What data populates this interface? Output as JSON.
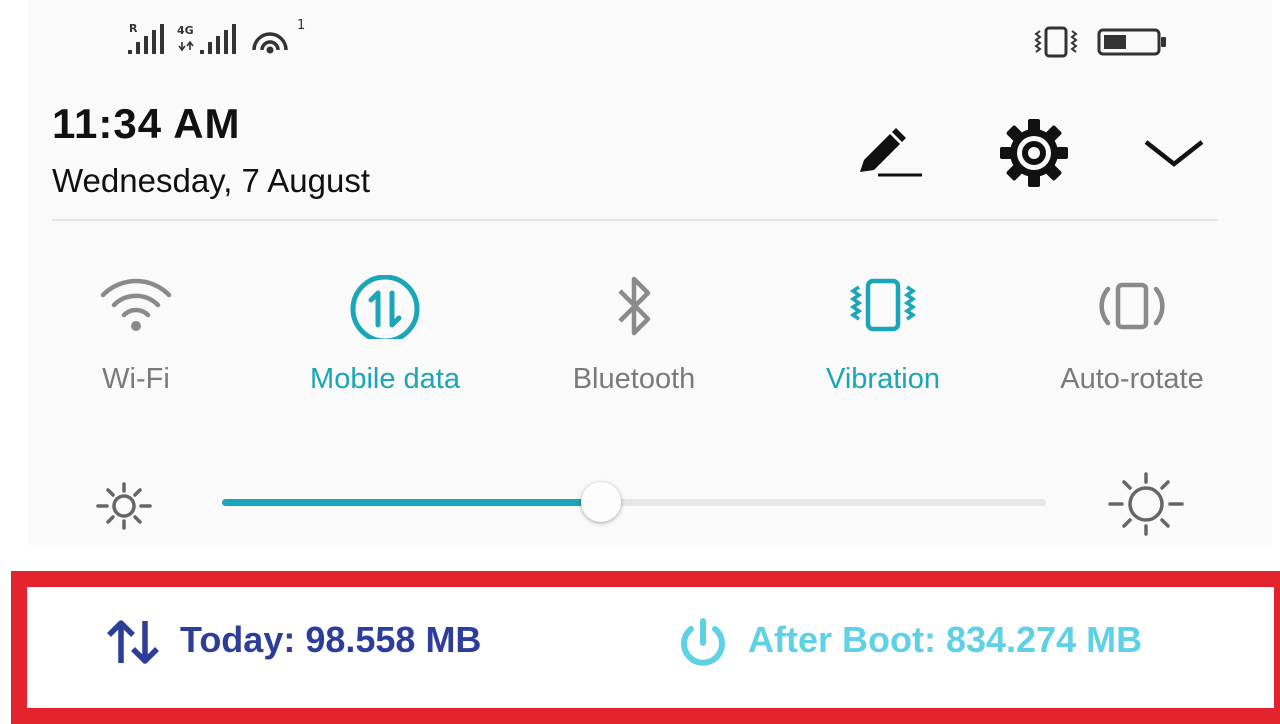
{
  "status_bar": {
    "roaming_label": "R",
    "network_label": "4G",
    "hotspot_count": "1"
  },
  "header": {
    "time": "11:34 AM",
    "date": "Wednesday, 7 August"
  },
  "tiles": [
    {
      "label": "Wi-Fi",
      "icon": "wifi-icon",
      "active": false
    },
    {
      "label": "Mobile data",
      "icon": "mobile-data-icon",
      "active": true
    },
    {
      "label": "Bluetooth",
      "icon": "bluetooth-icon",
      "active": false
    },
    {
      "label": "Vibration",
      "icon": "vibration-icon",
      "active": true
    },
    {
      "label": "Auto-rotate",
      "icon": "auto-rotate-icon",
      "active": false
    }
  ],
  "brightness": {
    "level": 0.46
  },
  "data_usage": {
    "today": "Today: 98.558 MB",
    "after_boot": "After Boot: 834.274 MB"
  },
  "colors": {
    "accent": "#1aa5b8",
    "today_text": "#2d3e9a",
    "boot_text": "#5fd1e6",
    "highlight_border": "#e3232b"
  }
}
